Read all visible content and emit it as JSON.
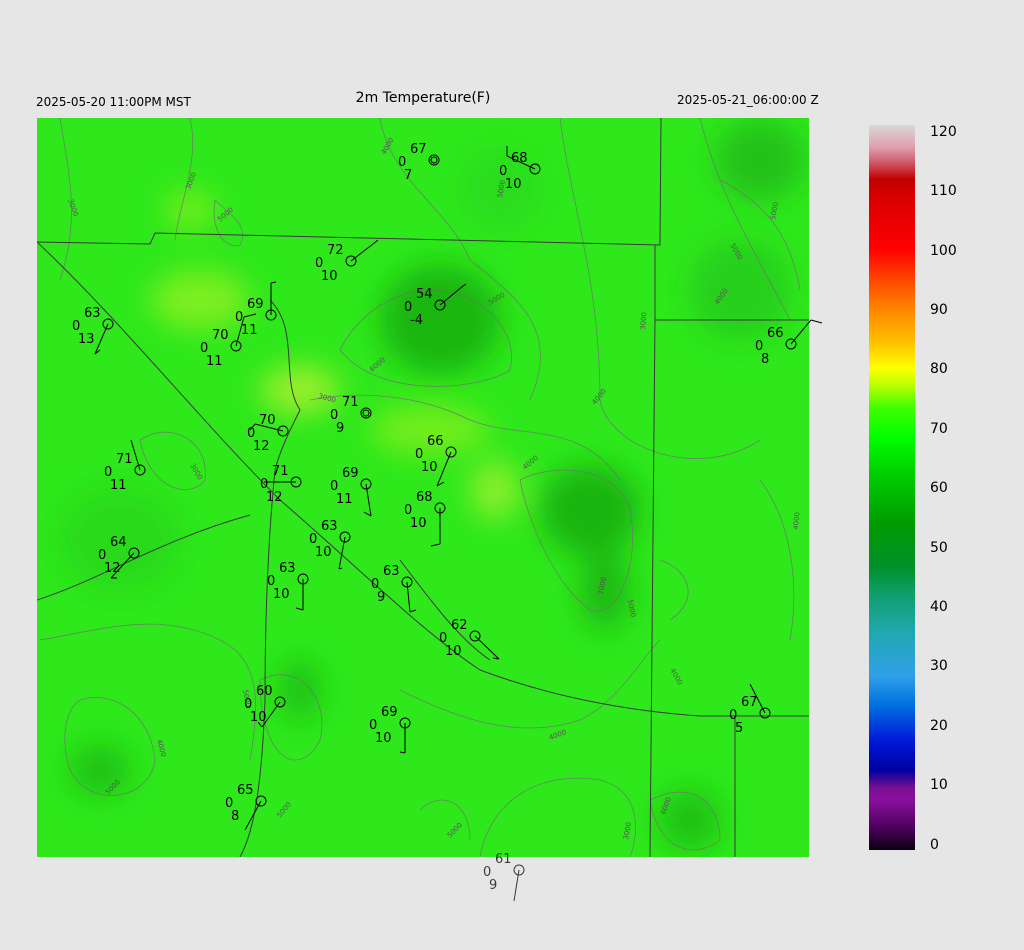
{
  "header": {
    "title": "2m Temperature(F)",
    "local_time": "2025-05-20 11:00PM MST",
    "utc_time": "2025-05-21_06:00:00 Z"
  },
  "colorbar": {
    "ticks": [
      "120",
      "110",
      "100",
      "90",
      "80",
      "70",
      "60",
      "50",
      "40",
      "30",
      "20",
      "10",
      "0"
    ]
  },
  "contour_labels": [
    "3000",
    "4000",
    "5000",
    "6000",
    "7000"
  ],
  "stations": [
    {
      "temp": "67",
      "dew": "0",
      "vis": "7"
    },
    {
      "temp": "68",
      "dew": "0",
      "vis": "10"
    },
    {
      "temp": "72",
      "dew": "0",
      "vis": "10"
    },
    {
      "temp": "54",
      "dew": "0",
      "vis": "-4"
    },
    {
      "temp": "63",
      "dew": "0",
      "vis": "13"
    },
    {
      "temp": "69",
      "dew": "0",
      "vis": "11"
    },
    {
      "temp": "70",
      "dew": "0",
      "vis": "11"
    },
    {
      "temp": "66",
      "dew": "0",
      "vis": "8"
    },
    {
      "temp": "71",
      "dew": "0",
      "vis": "9"
    },
    {
      "temp": "70",
      "dew": "0",
      "vis": "12"
    },
    {
      "temp": "66",
      "dew": "0",
      "vis": "10"
    },
    {
      "temp": "71",
      "dew": "0",
      "vis": "11"
    },
    {
      "temp": "71",
      "dew": "0",
      "vis": "12"
    },
    {
      "temp": "69",
      "dew": "0",
      "vis": "11"
    },
    {
      "temp": "68",
      "dew": "0",
      "vis": "10"
    },
    {
      "temp": "63",
      "dew": "0",
      "vis": "10"
    },
    {
      "temp": "64",
      "dew": "0",
      "vis": "12"
    },
    {
      "temp": "63",
      "dew": "0",
      "vis": "10"
    },
    {
      "temp": "63",
      "dew": "0",
      "vis": "9"
    },
    {
      "temp": "62",
      "dew": "0",
      "vis": "10"
    },
    {
      "temp": "60",
      "dew": "0",
      "vis": "10"
    },
    {
      "temp": "69",
      "dew": "0",
      "vis": "10"
    },
    {
      "temp": "67",
      "dew": "0",
      "vis": "5"
    },
    {
      "temp": "65",
      "dew": "0",
      "vis": "8"
    },
    {
      "temp": "61",
      "dew": "0",
      "vis": "9"
    }
  ]
}
